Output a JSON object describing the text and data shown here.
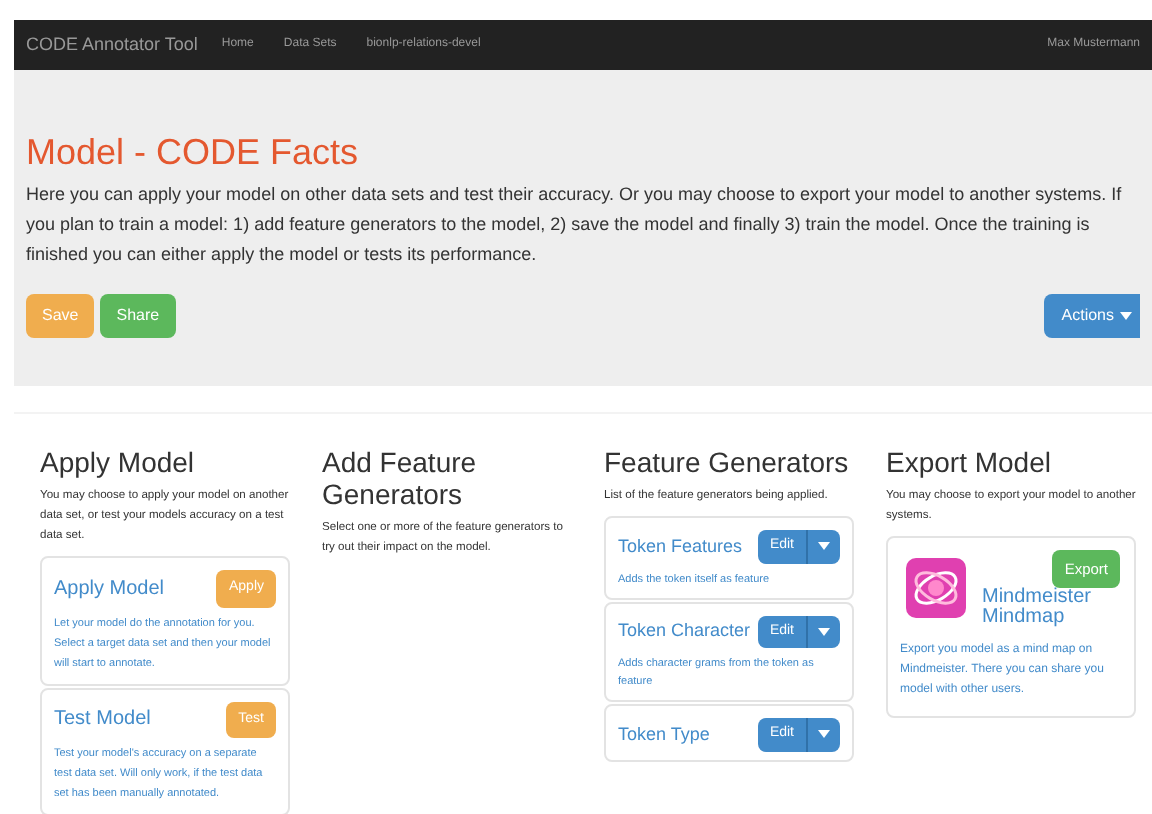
{
  "navbar": {
    "brand": "CODE Annotator Tool",
    "links": [
      "Home",
      "Data Sets",
      "bionlp-relations-devel"
    ],
    "user": "Max Mustermann"
  },
  "header": {
    "title": "Model - CODE Facts",
    "text": "Here you can apply your model on other data sets and test their accuracy. Or you may choose to export your model to another systems. If you plan to train a model: 1) add feature generators to the model, 2) save the model and finally 3) train the model. Once the training is finished you can either apply the model or tests its performance.",
    "buttons": [
      {
        "label": "Save",
        "kind": "warning"
      },
      {
        "label": "Share",
        "kind": "success"
      }
    ],
    "actions": "Actions"
  },
  "columns": [
    {
      "title": "Apply Model",
      "text": "You may choose to apply your model on another data set, or test your models accuracy on a test data set.",
      "cards": [
        {
          "kind": "action",
          "title": "Apply Model",
          "button": "Apply",
          "text": "Let your model do the annotation for you. Select a target data set and then your model will start to annotate."
        },
        {
          "kind": "action",
          "title": "Test Model",
          "button": "Test",
          "text": "Test your model's accuracy on a separate test data set. Will only work, if the test data set has been manually annotated."
        }
      ]
    },
    {
      "title": "Add Feature Generators",
      "text": "Select one or more of the feature generators to try out their impact on the model."
    },
    {
      "title": "Feature Generators",
      "text": "List of the feature generators being applied.",
      "cards": [
        {
          "kind": "edit",
          "title": "Token Features",
          "button": "Edit",
          "text": "Adds the token itself as feature"
        },
        {
          "kind": "edit",
          "title": "Token Character",
          "button": "Edit",
          "text": "Adds character grams from the token as feature"
        },
        {
          "kind": "edit",
          "title": "Token Type",
          "button": "Edit"
        }
      ]
    },
    {
      "title": "Export Model",
      "text": "You may choose to export your model to another systems.",
      "cards": [
        {
          "kind": "export",
          "title": "Mindmeister Mindmap",
          "button": "Export",
          "text": "Export you model as a mind map on Mindmeister. There you can share you model with other users."
        }
      ]
    }
  ]
}
